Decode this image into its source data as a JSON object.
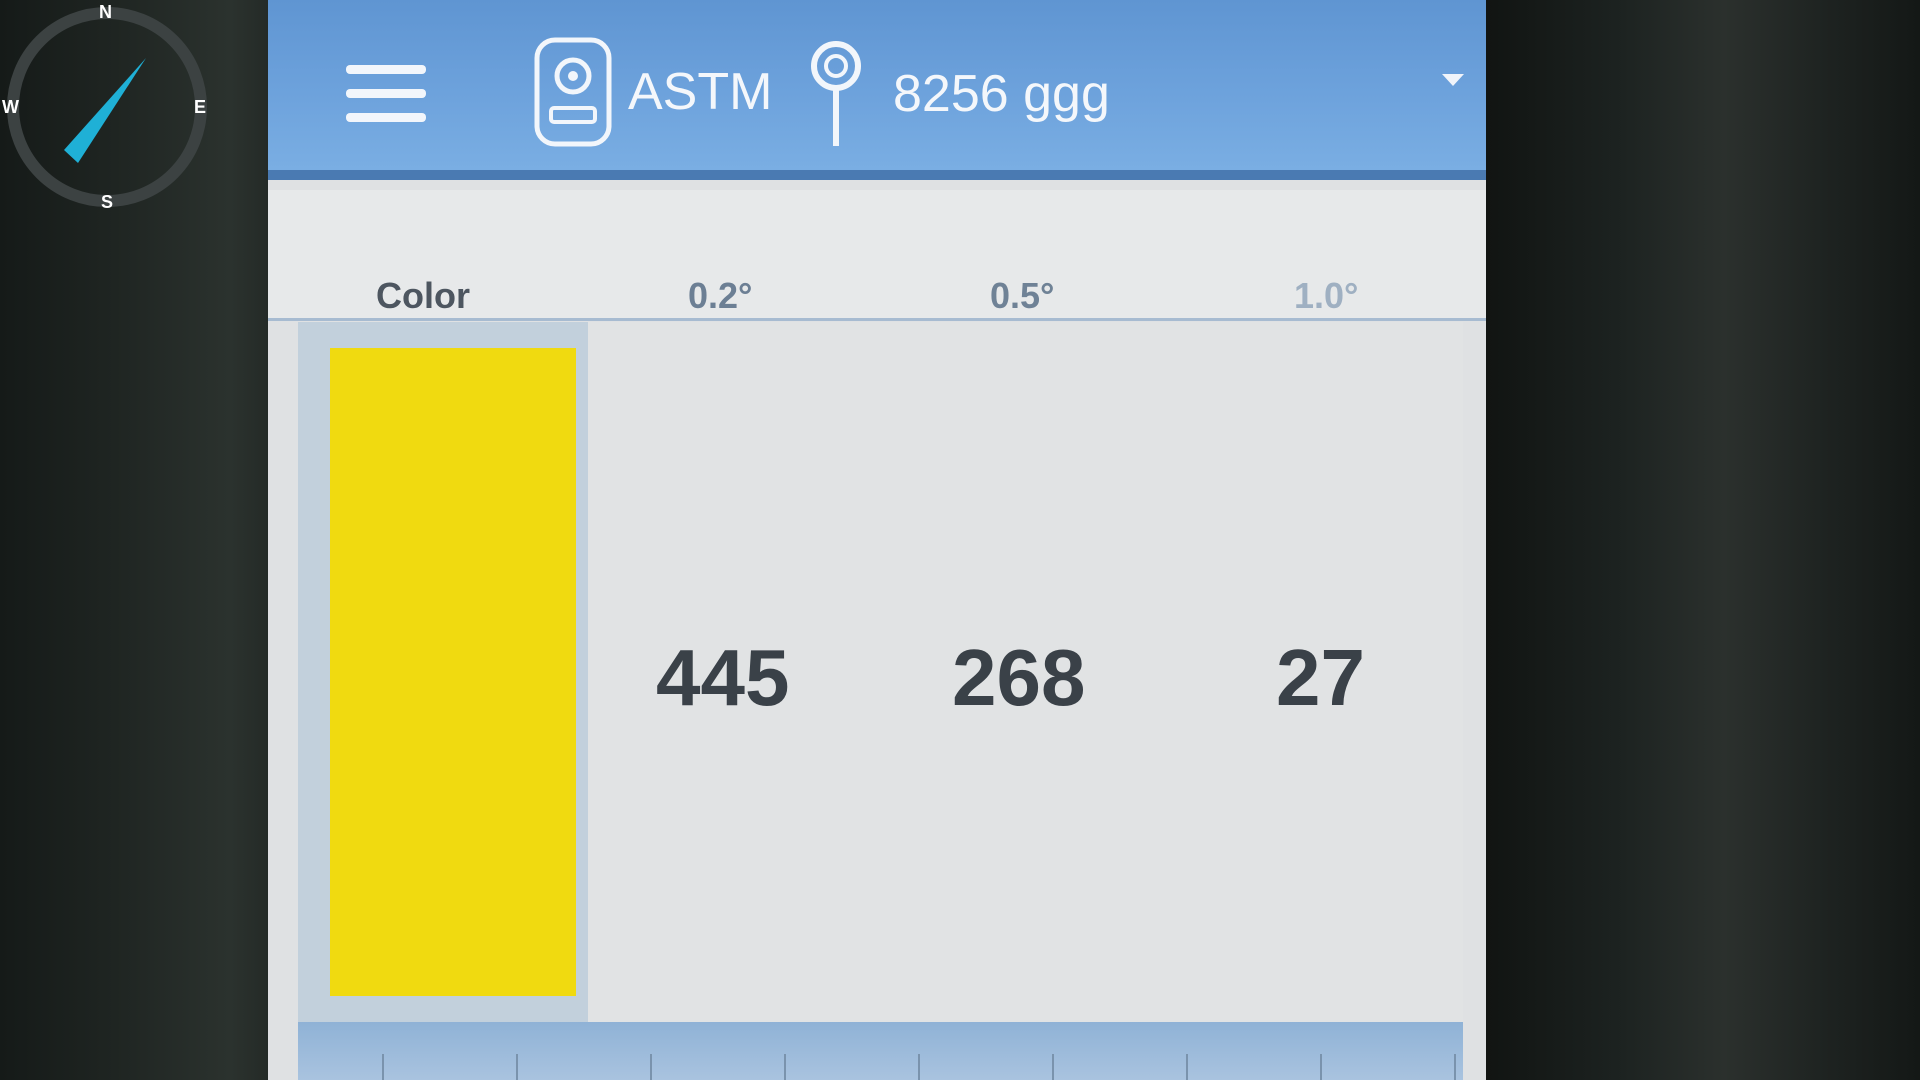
{
  "compass": {
    "n": "N",
    "s": "S",
    "w": "W",
    "e": "E",
    "needle_color": "#1fb0d6"
  },
  "header": {
    "device_icon": "device-icon",
    "device_label": "ASTM",
    "location_icon": "location-pin-icon",
    "location_label": "8256 ggg",
    "menu_icon": "menu-icon",
    "dropdown_icon": "chevron-down-icon"
  },
  "table": {
    "columns": [
      "Color",
      "0.2°",
      "0.5°",
      "1.0°"
    ],
    "row": {
      "color": "#f0da10",
      "values": [
        "445",
        "268",
        "27"
      ]
    }
  },
  "colors": {
    "accent": "#6da2dc",
    "swatch": "#f0da10"
  }
}
